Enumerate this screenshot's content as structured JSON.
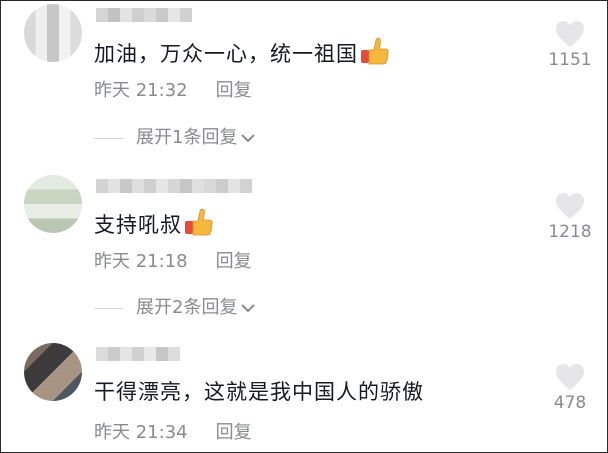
{
  "comments": [
    {
      "text": "加油，万众一心，统一祖国",
      "timestamp": "昨天 21:32",
      "reply_label": "回复",
      "likes": "1151",
      "expand_label": "展开1条回复"
    },
    {
      "text": "支持吼叔",
      "timestamp": "昨天 21:18",
      "reply_label": "回复",
      "likes": "1218",
      "expand_label": "展开2条回复"
    },
    {
      "text": "干得漂亮，这就是我中国人的骄傲",
      "timestamp": "昨天 21:34",
      "reply_label": "回复",
      "likes": "478"
    }
  ],
  "icons": {
    "like": "heart-icon",
    "emoji": "thumbs-up-emoji",
    "expand": "chevron-down-icon"
  },
  "colors": {
    "text": "#161823",
    "meta": "#8a8b91",
    "heart": "#e6e6e8",
    "thumb": "#f6b83c",
    "sleeve": "#e64a3b"
  }
}
